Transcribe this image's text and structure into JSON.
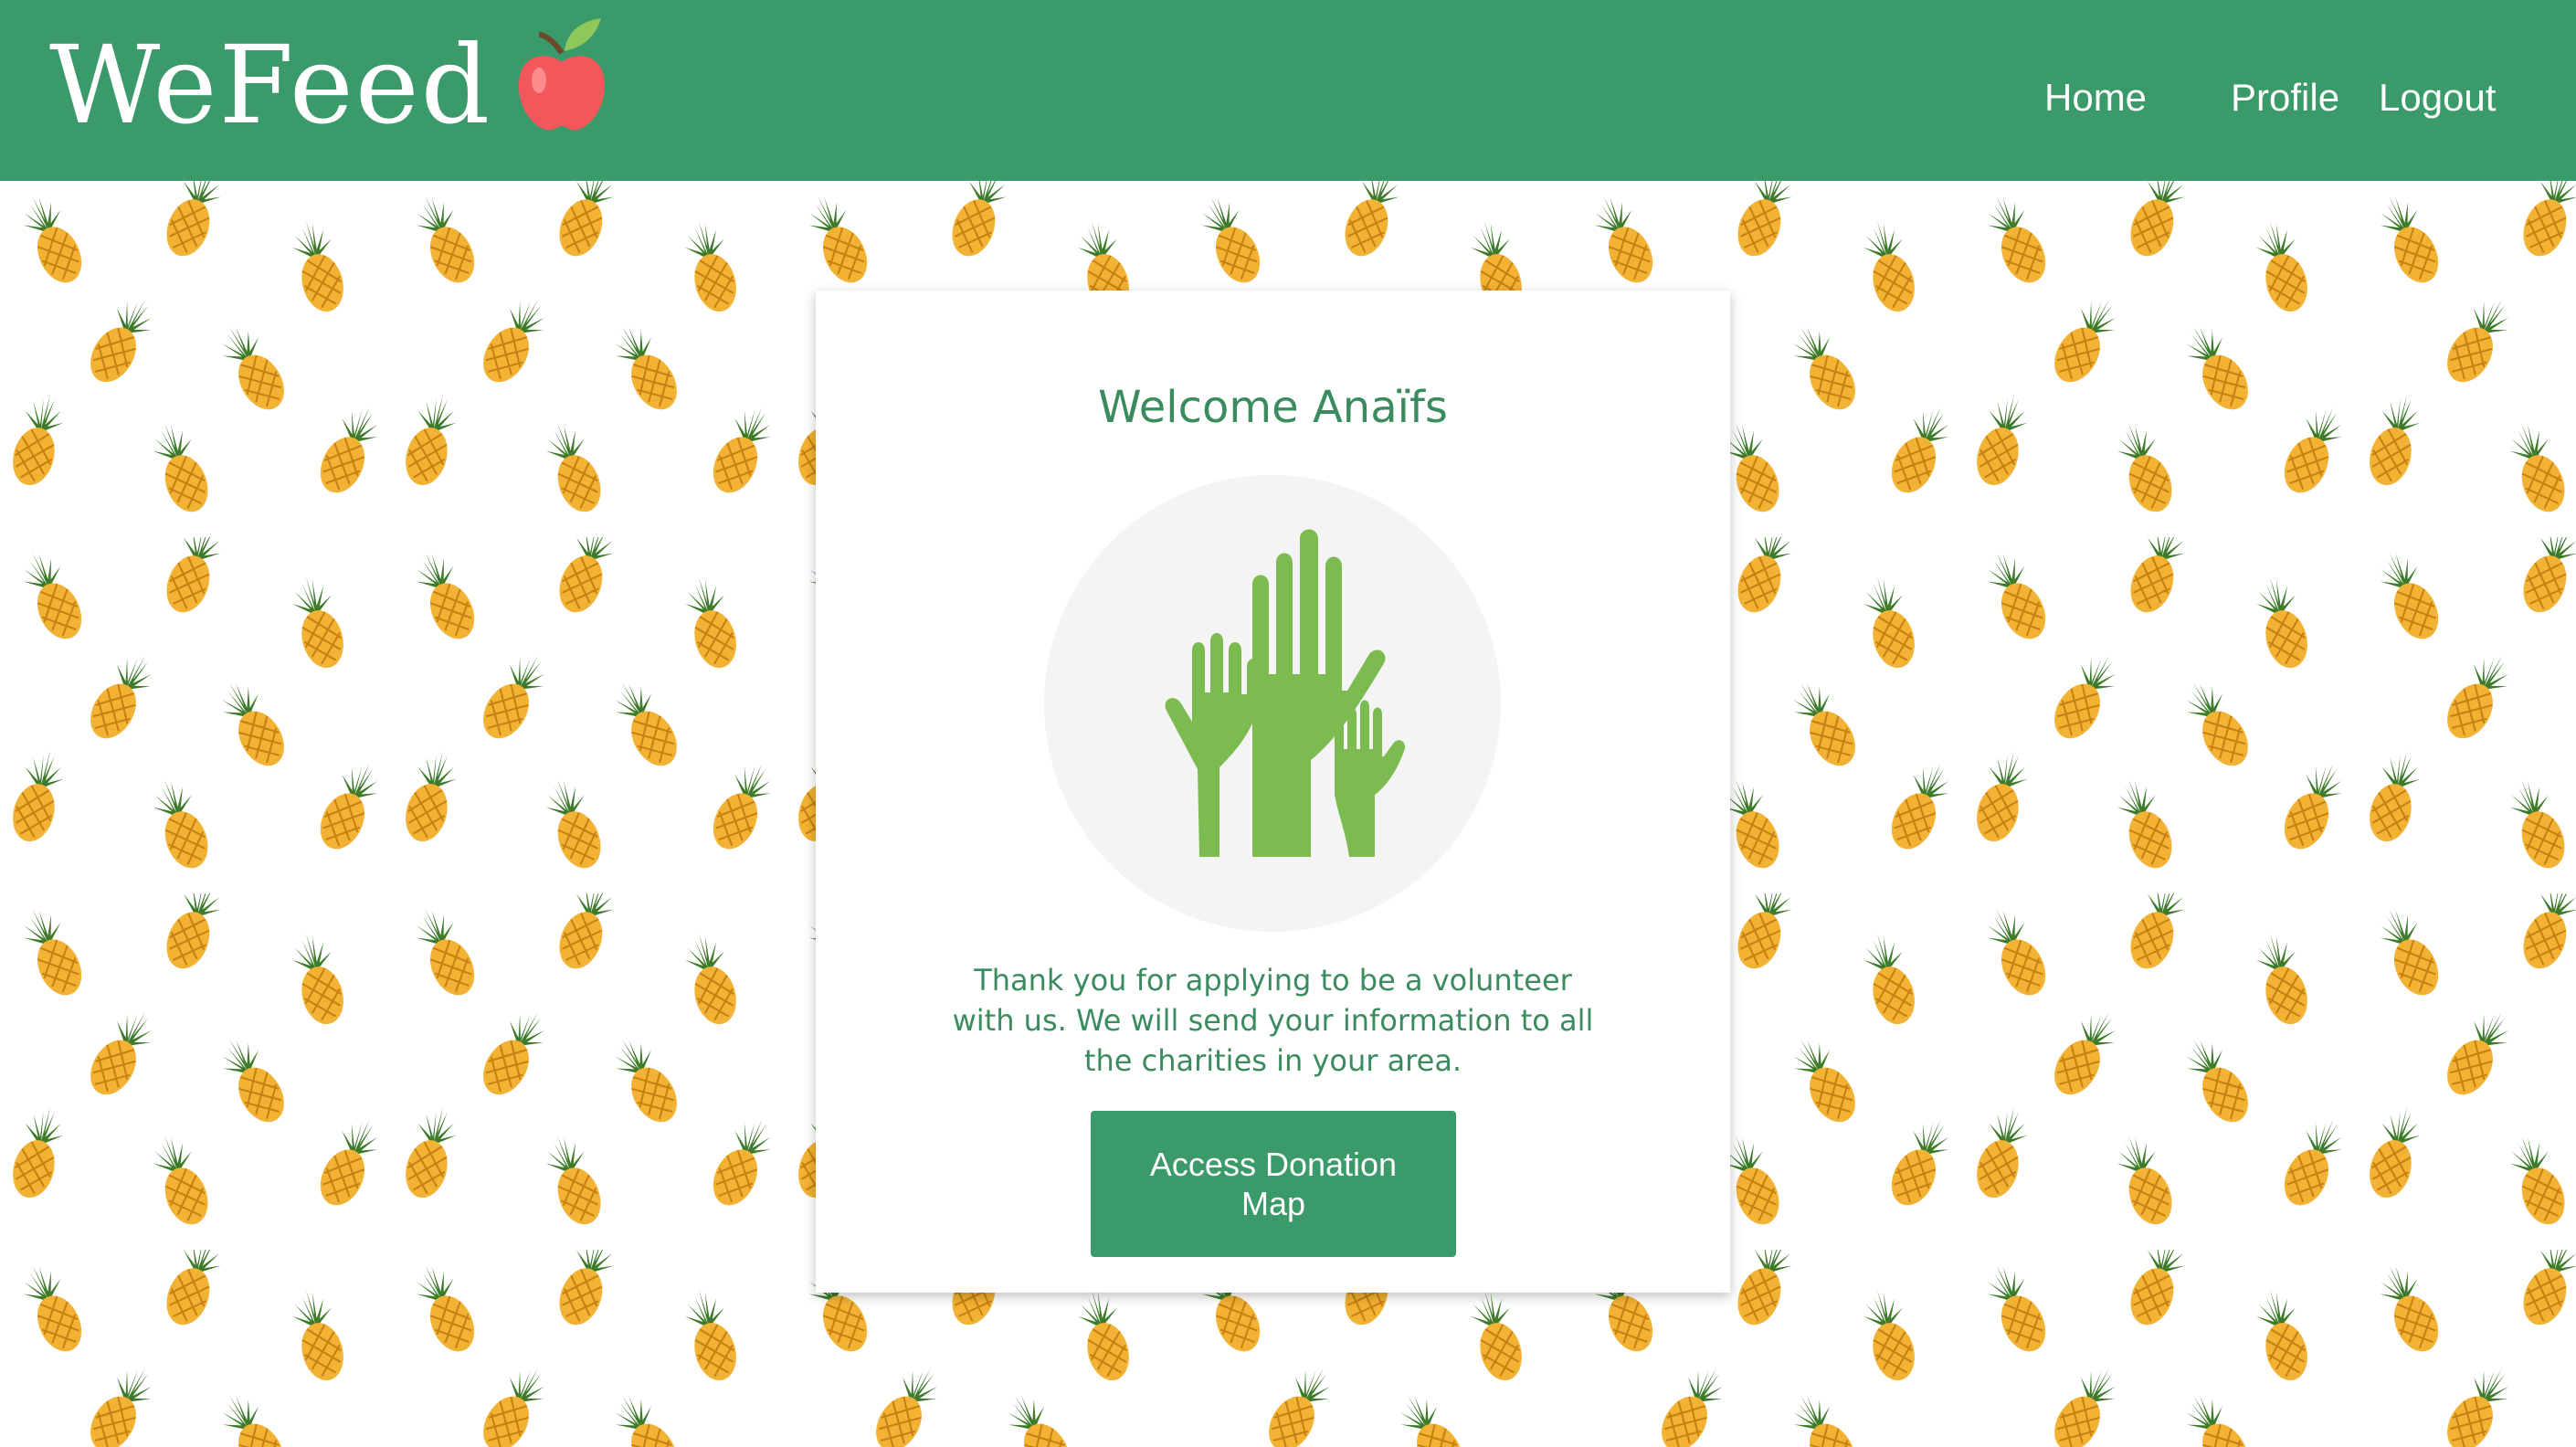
{
  "brand": {
    "name": "WeFeed",
    "logo_icon": "apple-icon"
  },
  "nav": {
    "home": "Home",
    "profile": "Profile",
    "logout": "Logout"
  },
  "card": {
    "title": "Welcome Anaïfs",
    "illustration_icon": "raised-hands-icon",
    "message": "Thank you for applying to be a volunteer with us. We will send your information to all the charities in your area.",
    "button_label": "Access Donation Map"
  },
  "background": {
    "pattern_icon": "pineapple-icon"
  },
  "colors": {
    "primary": "#3a9a69",
    "text_green": "#3a8c5e",
    "hands_green": "#7cbb4f",
    "circle_gray": "#f4f4f4",
    "pineapple_body": "#f2b233",
    "pineapple_leaf": "#3d7a2a"
  }
}
